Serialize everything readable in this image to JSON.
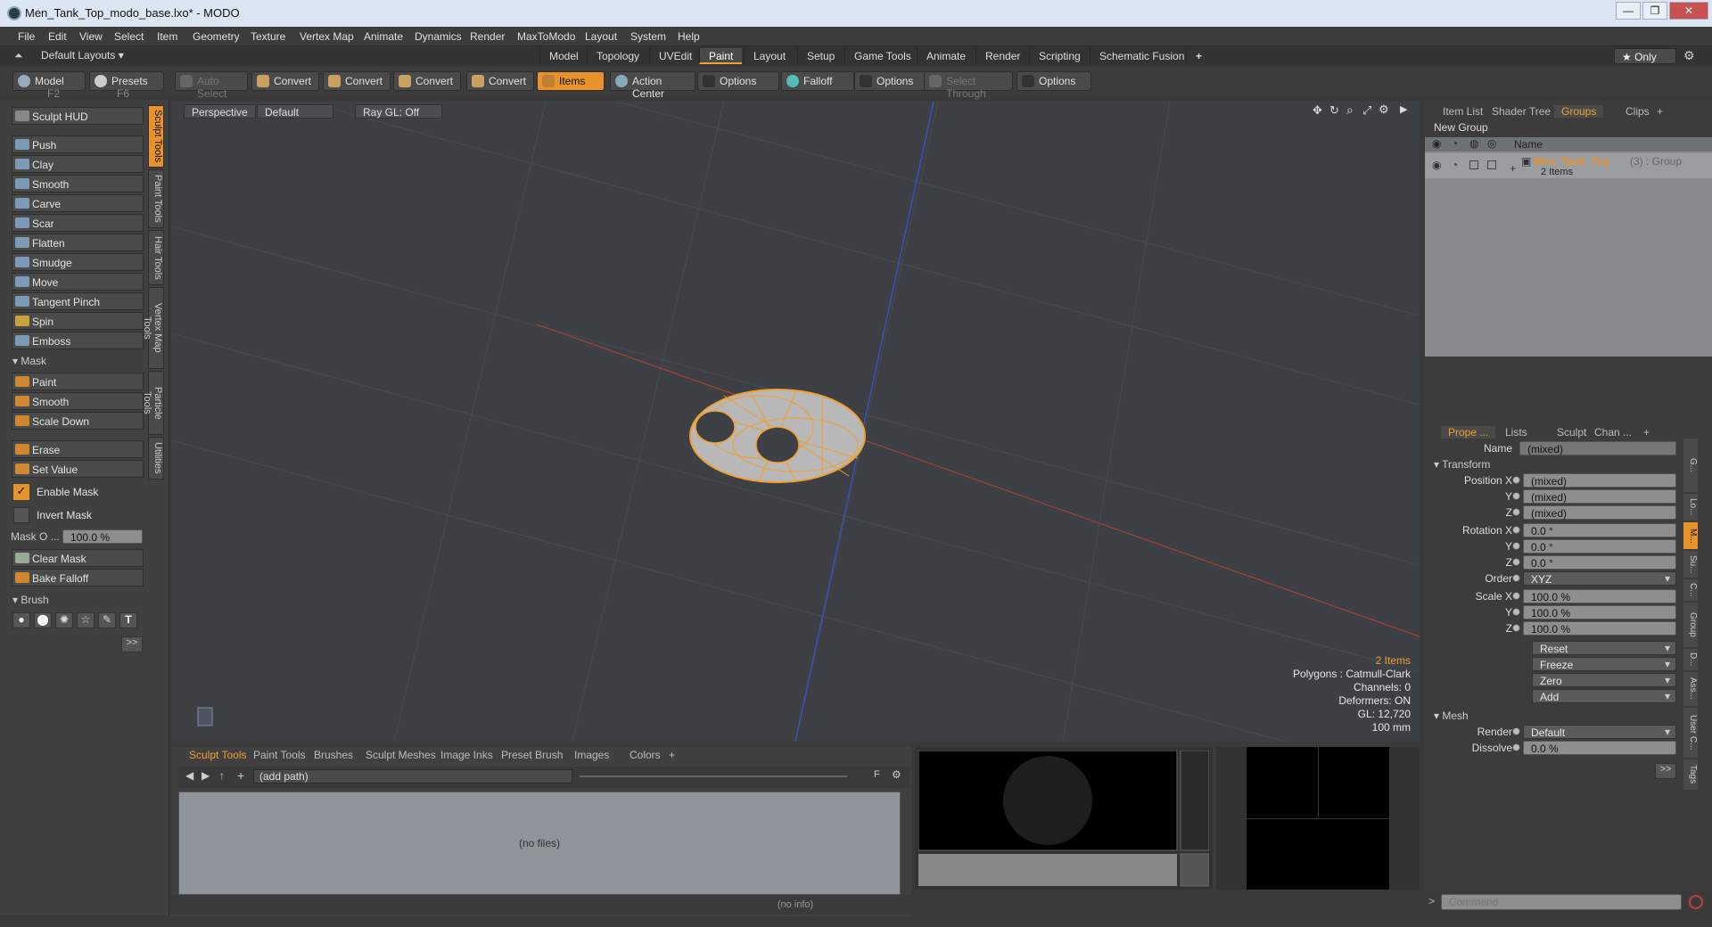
{
  "window": {
    "title": "Men_Tank_Top_modo_base.lxo* - MODO",
    "controls": [
      "—",
      "❐",
      "✕"
    ]
  },
  "menu": [
    "File",
    "Edit",
    "View",
    "Select",
    "Item",
    "Geometry",
    "Texture",
    "Vertex Map",
    "Animate",
    "Dynamics",
    "Render",
    "MaxToModo",
    "Layout",
    "System",
    "Help"
  ],
  "layoutbar": {
    "layouts_label": "Default Layouts ▾",
    "tabs": [
      "Model",
      "Topology",
      "UVEdit",
      "Paint",
      "Layout",
      "Setup",
      "Game Tools",
      "Animate",
      "Render",
      "Scripting",
      "Schematic Fusion",
      "+"
    ],
    "active_tab": "Paint",
    "only_label": "★ Only"
  },
  "toolbar": {
    "model": "Model",
    "model_key": "F2",
    "presets": "Presets",
    "presets_key": "F6",
    "auto_select": "Auto Select",
    "convert": "Convert",
    "items": "Items",
    "action_center": "Action Center",
    "options": "Options",
    "falloff": "Falloff",
    "select_through": "Select Through"
  },
  "sculpt": {
    "hud": "Sculpt HUD",
    "tools": [
      "Push",
      "Clay",
      "Smooth",
      "Carve",
      "Scar",
      "Flatten",
      "Smudge",
      "Move",
      "Tangent Pinch",
      "Spin",
      "Emboss"
    ],
    "mask_header": "Mask",
    "mask_tools": [
      "Paint",
      "Smooth",
      "Scale Down"
    ],
    "erase": "Erase",
    "set_value": "Set Value",
    "enable_mask": "Enable Mask",
    "invert_mask": "Invert Mask",
    "mask_opacity_label": "Mask O ...",
    "mask_opacity_value": "100.0 %",
    "clear_mask": "Clear Mask",
    "bake_falloff": "Bake Falloff",
    "brush_header": "Brush",
    "more": ">>"
  },
  "side_tabs": [
    "Sculpt Tools",
    "Paint Tools",
    "Hair Tools",
    "Vertex Map Tools",
    "Particle Tools",
    "Utilities"
  ],
  "viewport": {
    "view": "Perspective",
    "shading": "Default",
    "raygl": "Ray GL: Off",
    "stats": {
      "items": "2 Items",
      "polygons": "Polygons : Catmull-Clark",
      "channels": "Channels: 0",
      "deformers": "Deformers: ON",
      "gl": "GL: 12,720",
      "scale": "100 mm"
    }
  },
  "bottom": {
    "tabs": [
      "Sculpt Tools",
      "Paint Tools",
      "Brushes",
      "Sculpt Meshes",
      "Image Inks",
      "Preset Brush",
      "Images",
      "Colors",
      "+"
    ],
    "path": "(add path)",
    "empty": "(no files)",
    "info": "(no info)"
  },
  "right": {
    "tabs": [
      "Item List",
      "Shader Tree",
      "Groups",
      "Clips",
      "+"
    ],
    "new_group": "New Group",
    "col_name": "Name",
    "group_name": "Men_Tank_Top",
    "group_suffix": "(3) : Group",
    "group_items": "2 Items",
    "prop_tabs": [
      "Prope ...",
      "Lists",
      "Sculpt",
      "Chan ...",
      "+"
    ],
    "name_label": "Name",
    "name_value": "(mixed)",
    "transform": "Transform",
    "position_x": "Position X",
    "y": "Y",
    "z": "Z",
    "mixed": "(mixed)",
    "rotation_x": "Rotation X",
    "rot_val": "0.0 °",
    "order": "Order",
    "order_val": "XYZ",
    "scale_x": "Scale X",
    "scale_val": "100.0 %",
    "reset": "Reset",
    "freeze": "Freeze",
    "zero": "Zero",
    "add": "Add",
    "mesh": "Mesh",
    "render": "Render",
    "render_val": "Default",
    "dissolve": "Dissolve",
    "dissolve_val": "0.0 %",
    "more": ">>",
    "command": "Command",
    "side_tabs": [
      "G...",
      "Lo...",
      "M...",
      "Su...",
      "C...",
      "Group",
      "D...",
      "Ass...",
      "User C...",
      "Tags"
    ]
  },
  "colors": {
    "accent": "#e8932a",
    "mesh": "#f0a030",
    "xaxis": "#c04030",
    "yaxis": "#3050c0"
  }
}
